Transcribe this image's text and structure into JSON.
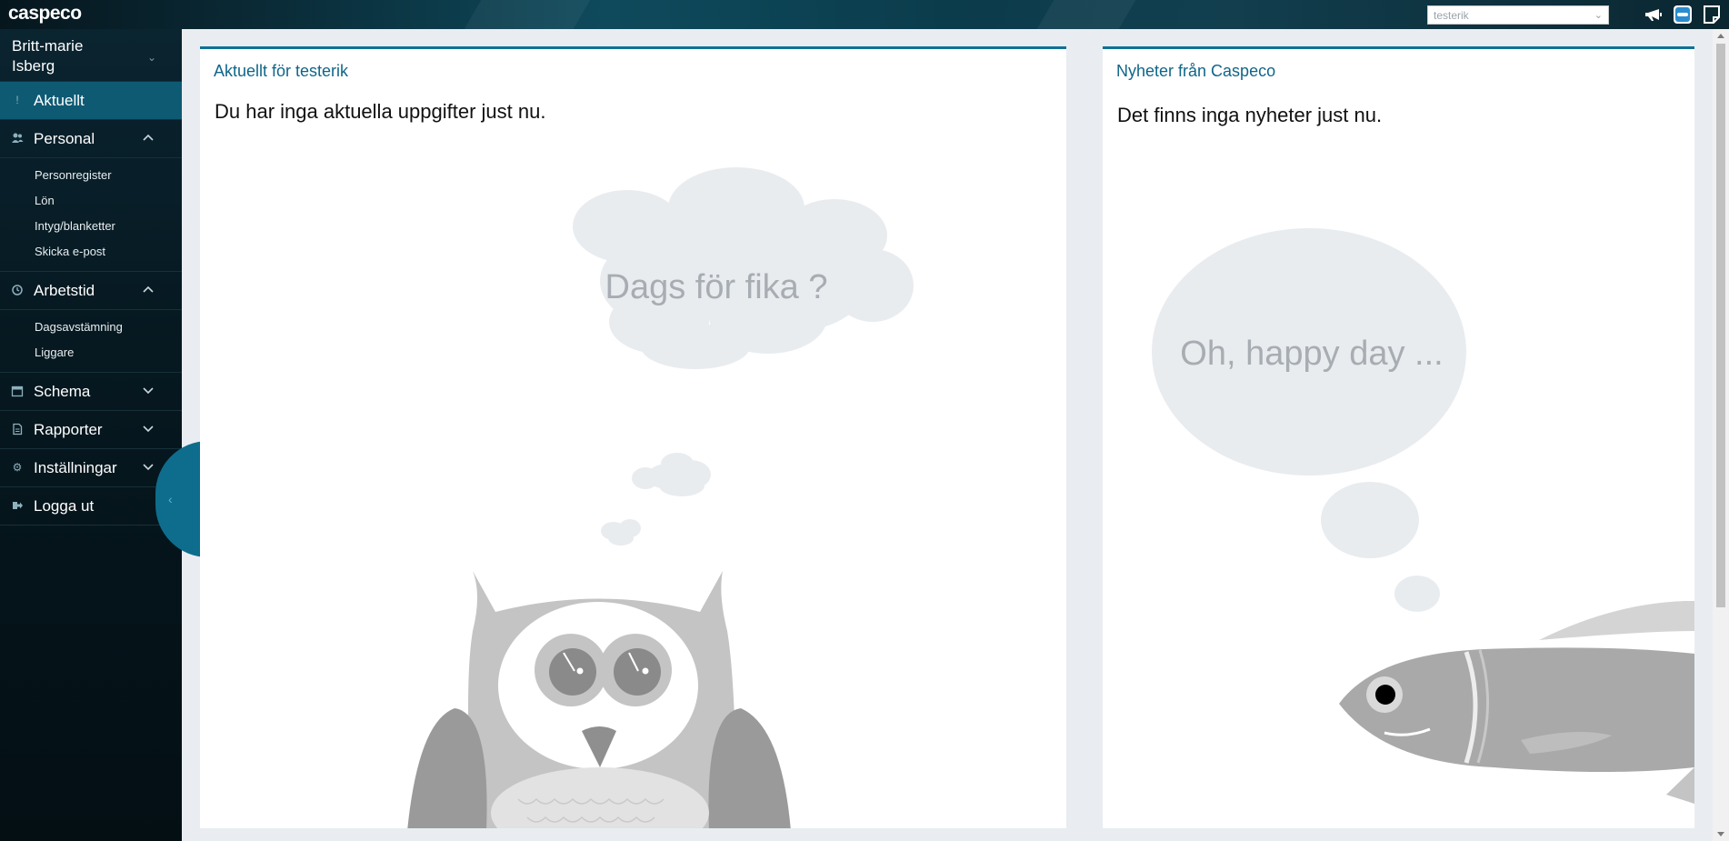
{
  "header": {
    "logo": "caspeco",
    "user_select_value": "testerik"
  },
  "sidebar": {
    "user_name_line1": "Britt-marie",
    "user_name_line2": "Isberg",
    "items": [
      {
        "label": "Aktuellt",
        "icon": "exclamation-icon"
      },
      {
        "label": "Personal",
        "icon": "users-icon",
        "sub": [
          "Personregister",
          "Lön",
          "Intyg/blanketter",
          "Skicka e-post"
        ]
      },
      {
        "label": "Arbetstid",
        "icon": "clock-icon",
        "sub": [
          "Dagsavstämning",
          "Liggare"
        ]
      },
      {
        "label": "Schema",
        "icon": "calendar-icon"
      },
      {
        "label": "Rapporter",
        "icon": "document-icon"
      },
      {
        "label": "Inställningar",
        "icon": "gear-icon"
      },
      {
        "label": "Logga ut",
        "icon": "logout-icon"
      }
    ]
  },
  "main": {
    "left_panel": {
      "title": "Aktuellt för testerik",
      "message": "Du har inga aktuella uppgifter just nu.",
      "bubble_text": "Dags för fika ?"
    },
    "right_panel": {
      "title": "Nyheter från Caspeco",
      "message": "Det finns inga nyheter just nu.",
      "bubble_text": "Oh, happy day ..."
    }
  },
  "colors": {
    "accent": "#0f7196",
    "active_nav": "#0e5a73",
    "illustration_light": "#e9ecef",
    "illustration_text": "#a7adb2"
  }
}
